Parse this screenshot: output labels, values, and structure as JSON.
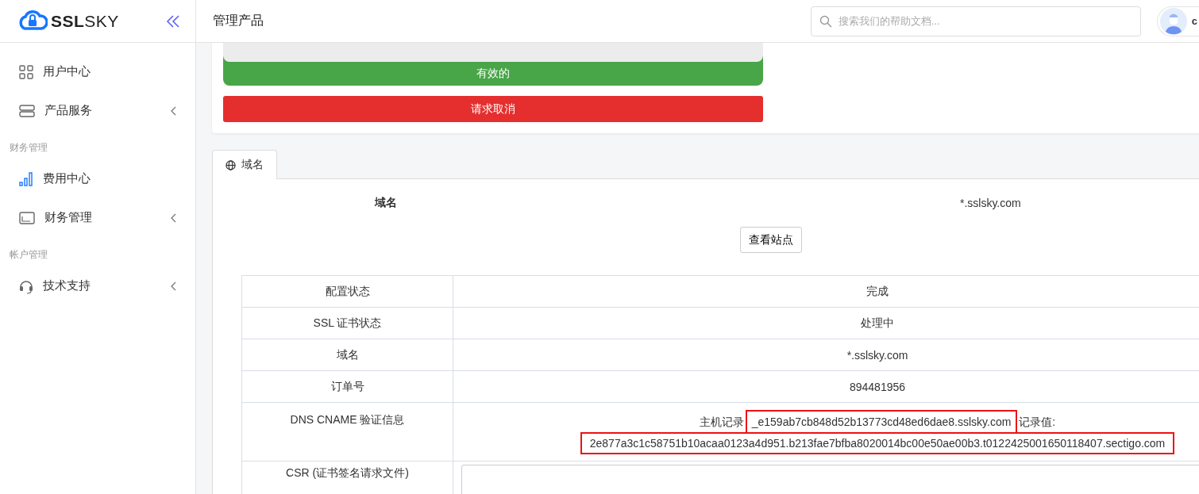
{
  "sidebar": {
    "logo": {
      "bold": "SSL",
      "light": "SKY"
    },
    "sections": [
      {
        "items": [
          {
            "label": "用户中心",
            "has_submenu": false
          },
          {
            "label": "产品服务",
            "has_submenu": true
          }
        ]
      },
      {
        "heading": "财务管理",
        "items": [
          {
            "label": "费用中心",
            "has_submenu": false
          },
          {
            "label": "财务管理",
            "has_submenu": true
          }
        ]
      },
      {
        "heading": "帐户管理",
        "items": [
          {
            "label": "技术支持",
            "has_submenu": true
          }
        ]
      }
    ]
  },
  "header": {
    "title": "管理产品",
    "search": {
      "placeholder": "搜索我们的帮助文档..."
    },
    "user": {
      "name": "c"
    }
  },
  "status_card": {
    "status": "有效的",
    "cancel_button": "请求取消"
  },
  "tabs": [
    {
      "label": "域名",
      "selected": true
    }
  ],
  "domain": {
    "label": "域名",
    "value": "*.sslsky.com",
    "view_button": "查看站点"
  },
  "table": {
    "rows": [
      {
        "kind": "text",
        "label": "配置状态",
        "value": "完成"
      },
      {
        "kind": "text",
        "label": "SSL 证书状态",
        "value": "处理中"
      },
      {
        "kind": "text",
        "label": "域名",
        "value": "*.sslsky.com"
      },
      {
        "kind": "text",
        "label": "订单号",
        "value": "894481956"
      },
      {
        "kind": "cname",
        "label": "DNS CNAME 验证信息",
        "host_label": "主机记录",
        "host": "_e159ab7cb848d52b13773cd48ed6dae8.sslsky.com",
        "host_highlighted": true,
        "record_label": "记录值:",
        "record": "2e877a3c1c58751b10acaa0123a4d951.b213fae7bfba8020014bc00e50ae00b3.t0122425001650118407.sectigo.com",
        "record_highlighted": true
      },
      {
        "kind": "csr",
        "label": "CSR (证书签名请求文件)"
      }
    ]
  }
}
